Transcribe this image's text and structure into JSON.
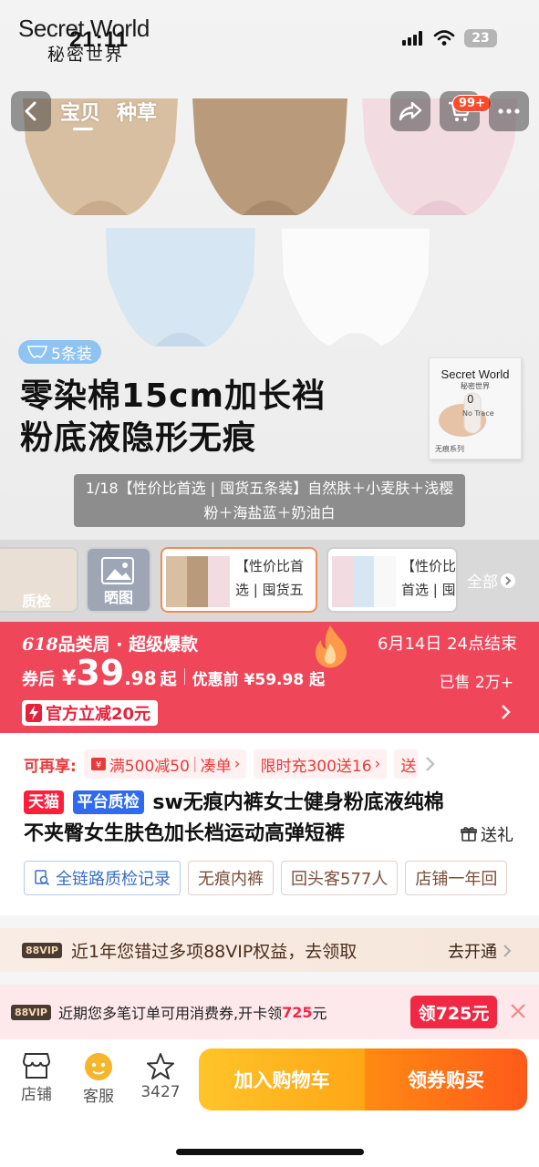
{
  "status_bar": {
    "time": "21:11",
    "battery": "23"
  },
  "brand": {
    "name_en": "Secret World",
    "name_zh": "秘密世界"
  },
  "nav": {
    "tabs": [
      "宝贝",
      "种草"
    ],
    "cart_badge": "99+"
  },
  "hero": {
    "pack_badge": "5条装",
    "title_line1": "零染棉15cm加长裆",
    "title_line2": "粉底液隐形无痕",
    "promo_card": {
      "brand": "Secret World",
      "brand_zh": "秘密世界",
      "badge": "0",
      "product": "No Trace",
      "series": "无痕系列"
    },
    "description": "1/18【性价比首选 | 囤货五条装】自然肤＋小麦肤＋浅樱粉＋海盐蓝＋奶油白",
    "colors": {
      "nude": "#d9bfa2",
      "wheat": "#b99a7a",
      "pink": "#f3dbe2",
      "blue": "#d6e6f3",
      "white": "#f8f8f8"
    }
  },
  "thumbnails": {
    "items": [
      {
        "label": "质检"
      },
      {
        "label": "晒图"
      },
      {
        "label": "【性价比首选 | 囤货五"
      },
      {
        "label": "【性价比首选 | 囤货"
      }
    ],
    "all_label": "全部"
  },
  "price_banner": {
    "event_prefix": "618",
    "event_name": "品类周 · 超级爆款",
    "event_end": "6月14日 24点结束",
    "after_coupon_label": "券后",
    "currency": "¥",
    "price_int": "39",
    "price_dec": ".98",
    "price_suffix": "起",
    "before_label": "优惠前 ¥59.98 起",
    "sold": "已售 2万+",
    "discount": "官方立减20元"
  },
  "offers": {
    "label": "可再享:",
    "coupons": [
      "满500减50",
      "凑单",
      "限时充300送16",
      "送"
    ]
  },
  "product": {
    "tag_tmall": "天猫",
    "tag_check": "平台质检",
    "title": "sw无痕内裤女士健身粉底液纯棉不夹臀女生肤色加长档运动高弹短裤",
    "gift": "送礼",
    "features": [
      "全链路质检记录",
      "无痕内裤",
      "回头客577人",
      "店铺一年回"
    ]
  },
  "vip": {
    "chip": "88VIP",
    "text": "近1年您错过多项88VIP权益，去领取",
    "cta": "去开通"
  },
  "coupon_notice": {
    "chip": "88VIP",
    "text_before": "近期您多笔订单可用消费券,开卡领",
    "amount": "725",
    "text_after": "元",
    "claim_label": "领725元"
  },
  "bottom_bar": {
    "store": "店铺",
    "service": "客服",
    "favorites": "3427",
    "add_to_cart": "加入购物车",
    "buy_now": "领券购买"
  }
}
